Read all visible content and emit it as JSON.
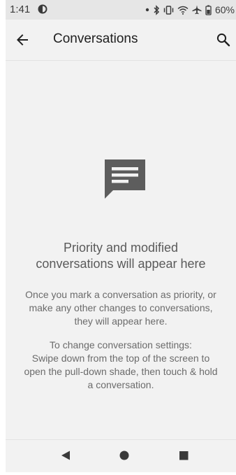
{
  "status_bar": {
    "time": "1:41",
    "battery": "60%",
    "icons": [
      "app-notification-icon",
      "dot-icon",
      "bluetooth-icon",
      "vibrate-icon",
      "wifi-icon",
      "airplane-icon",
      "battery-icon"
    ]
  },
  "app_bar": {
    "title": "Conversations",
    "back_icon": "back-arrow-icon",
    "search_icon": "search-icon"
  },
  "empty_state": {
    "icon": "message-icon",
    "title_lines": [
      "Priority and modified",
      "conversations will appear here"
    ],
    "body_1_lines": [
      "Once you mark a conversation as priority, or",
      "make any other changes to conversations,",
      "they will appear here."
    ],
    "body_2_lines": [
      "To change conversation settings:",
      "Swipe down from the top of the screen to",
      "open the pull-down shade, then touch & hold",
      "a conversation."
    ]
  },
  "nav_bar": {
    "icons": [
      "nav-back-icon",
      "nav-home-icon",
      "nav-recents-icon"
    ]
  }
}
